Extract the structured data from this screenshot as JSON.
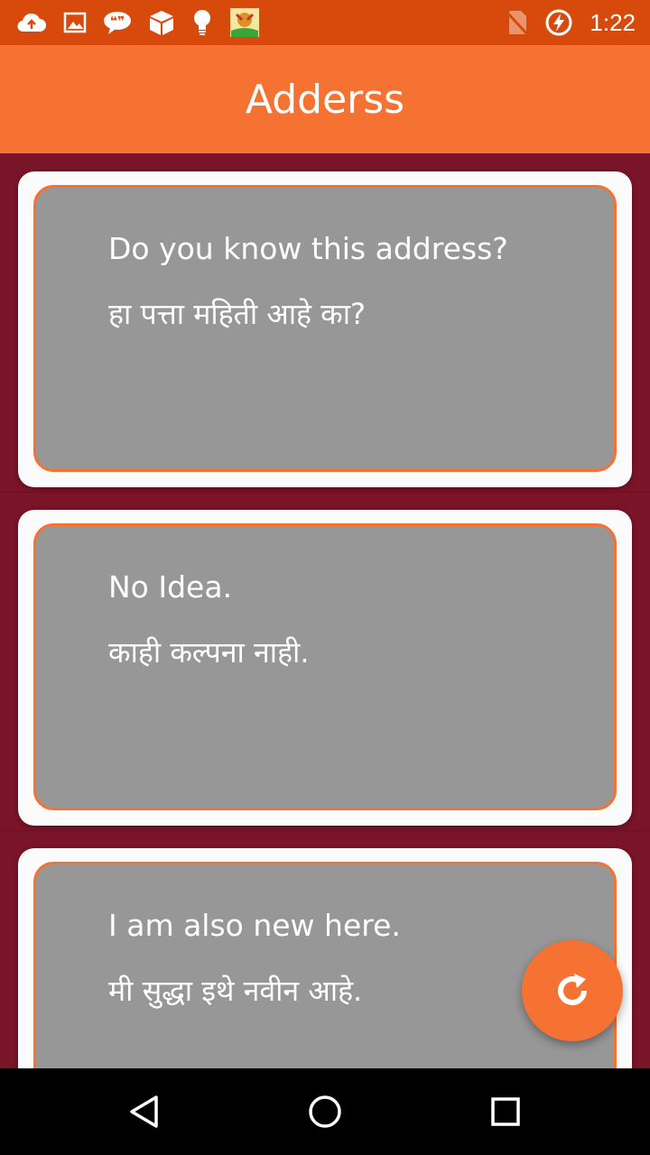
{
  "status_bar": {
    "time": "1:22",
    "left_icons": [
      "cloud-upload-icon",
      "image-icon",
      "chat-quote-icon",
      "box-icon",
      "lightbulb-icon",
      "app-thumbnail-icon"
    ],
    "right_icons": [
      "no-sim-icon",
      "battery-charging-icon"
    ]
  },
  "app_bar": {
    "title": "Adderss"
  },
  "cards": [
    {
      "english": "Do you know this address?",
      "marathi": "हा पत्ता महिती आहे का?"
    },
    {
      "english": "No Idea.",
      "marathi": "काही कल्पना नाही."
    },
    {
      "english": "I am also new here.",
      "marathi": "मी सुद्धा इथे नवीन आहे."
    }
  ],
  "fab": {
    "icon": "refresh-icon"
  },
  "nav_bar": {
    "icons": [
      "back-icon",
      "home-icon",
      "recents-icon"
    ]
  },
  "colors": {
    "status_bar": "#d84a0c",
    "app_bar": "#f57233",
    "background": "#7a1428",
    "card_inner": "#979797",
    "accent": "#f57233"
  }
}
